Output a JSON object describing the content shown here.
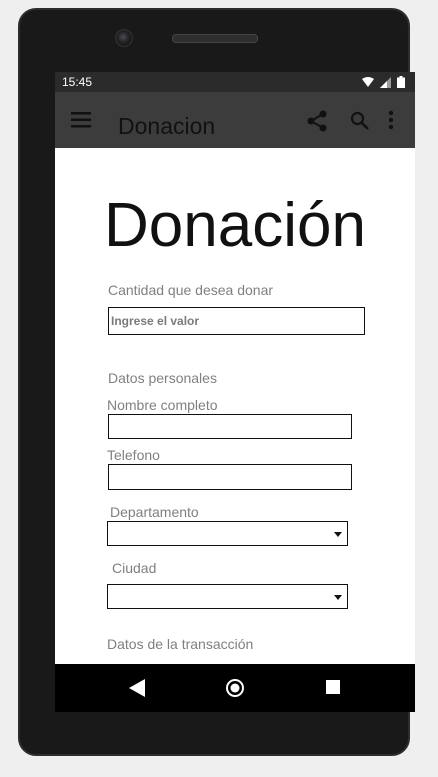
{
  "status_bar": {
    "time": "15:45"
  },
  "app_bar": {
    "title": "Donacion"
  },
  "page": {
    "heading": "Donación",
    "amount_label": "Cantidad que desea donar",
    "amount_placeholder": "Ingrese el valor",
    "personal_section": "Datos personales",
    "name_label": "Nombre completo",
    "name_value": "",
    "phone_label": "Telefono",
    "phone_value": "",
    "department_label": "Departamento",
    "department_value": "",
    "city_label": "Ciudad",
    "city_value": "",
    "transaction_section": "Datos de la transacción"
  },
  "icons": {
    "menu": "menu-icon",
    "share": "share-icon",
    "search": "search-icon",
    "more": "more-vert-icon",
    "back": "back-icon",
    "home": "home-icon",
    "recent": "recent-apps-icon"
  },
  "colors": {
    "app_bar": "#3c3c3c",
    "status_bar": "#2b2b2b",
    "nav_bar": "#000000",
    "label_gray": "#808080"
  }
}
